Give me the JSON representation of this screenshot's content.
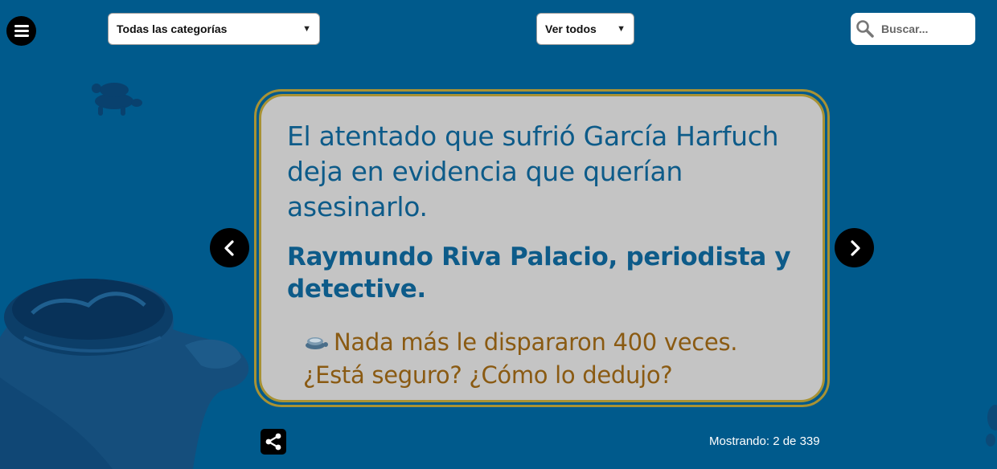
{
  "header": {
    "menu_icon": "hamburger-icon",
    "category_select": {
      "selected": "Todas las categorías",
      "icon": "chevron-down-icon"
    },
    "view_select": {
      "selected": "Ver todos",
      "icon": "chevron-down-icon"
    },
    "search": {
      "placeholder": "Buscar...",
      "value": "",
      "icon": "search-icon"
    }
  },
  "card": {
    "quote": "El atentado que sufrió García Harfuch deja en evidencia que querían asesinarlo.",
    "author": "Raymundo Riva Palacio, periodista y detective.",
    "comment": "Nada más le dispararon 400 veces. ¿Está seguro? ¿Cómo lo dedujo?",
    "comment_icon": "turtle-emoji-icon"
  },
  "navigation": {
    "prev_icon": "chevron-left-icon",
    "next_icon": "chevron-right-icon"
  },
  "footer": {
    "share_icon": "share-icon",
    "counter": "Mostrando: 2 de 339"
  },
  "colors": {
    "background": "#005a8c",
    "card_fill": "#c4c4c4",
    "card_border": "#a89234",
    "quote_text": "#0d5b89",
    "comment_text": "#8a5a12"
  }
}
